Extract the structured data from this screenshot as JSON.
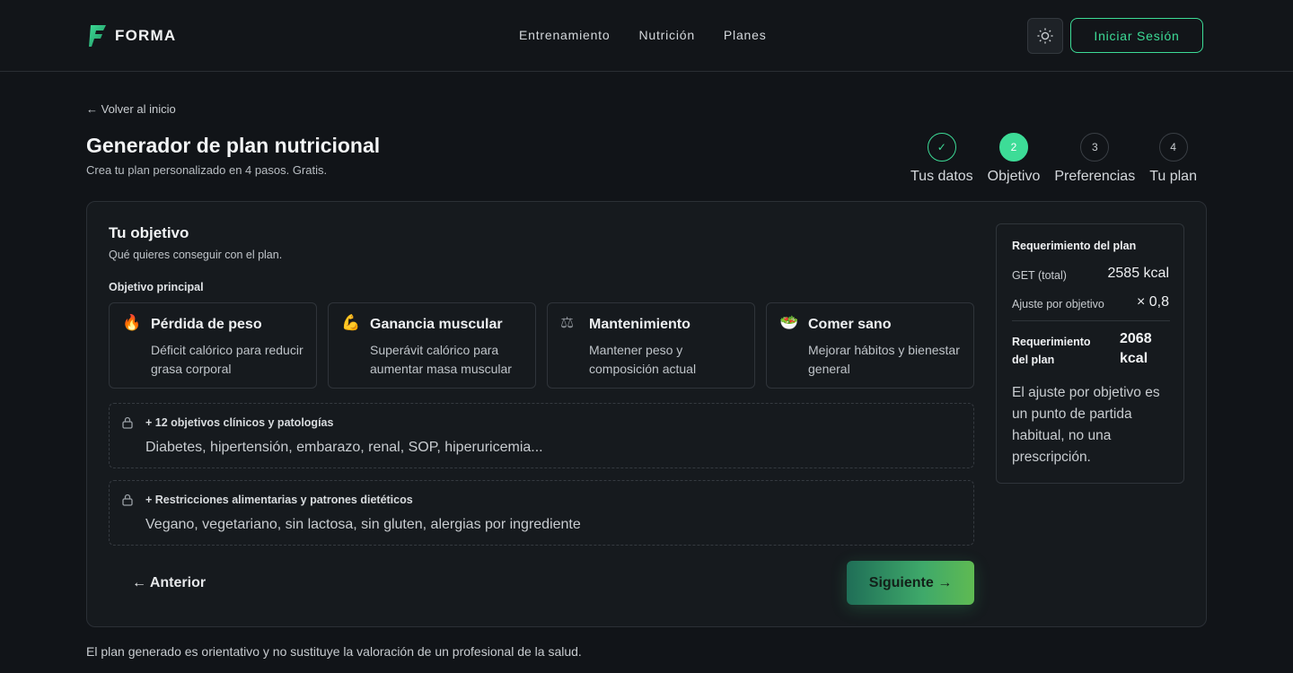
{
  "header": {
    "brand": "FORMA",
    "nav": [
      "Entrenamiento",
      "Nutrición",
      "Planes"
    ],
    "login_label": "Iniciar Sesión",
    "theme_icon": "sun-icon"
  },
  "page": {
    "back_link": "← Volver al inicio",
    "title": "Generador de plan nutricional",
    "subtitle": "Crea tu plan personalizado en 4 pasos. Gratis."
  },
  "stepper": {
    "steps": [
      {
        "number": "✓",
        "label": "Tus datos",
        "state": "done"
      },
      {
        "number": "2",
        "label": "Objetivo",
        "state": "active"
      },
      {
        "number": "3",
        "label": "Preferencias",
        "state": "pending"
      },
      {
        "number": "4",
        "label": "Tu plan",
        "state": "pending"
      }
    ]
  },
  "objective": {
    "title": "Tu objetivo",
    "subtitle": "Qué quieres conseguir con el plan.",
    "field_label": "Objetivo principal",
    "options": [
      {
        "icon": "🔥",
        "icon_name": "fire-icon",
        "title": "Pérdida de peso",
        "desc": "Déficit calórico para reducir grasa corporal"
      },
      {
        "icon": "💪",
        "icon_name": "muscle-icon",
        "title": "Ganancia muscular",
        "desc": "Superávit calórico para aumentar masa muscular"
      },
      {
        "icon": "⚖",
        "icon_name": "scale-icon",
        "title": "Mantenimiento",
        "desc": "Mantener peso y composición actual"
      },
      {
        "icon": "🥗",
        "icon_name": "salad-icon",
        "title": "Comer sano",
        "desc": "Mejorar hábitos y bienestar general"
      }
    ],
    "locked": [
      {
        "title": "+ 12 objetivos clínicos y patologías",
        "desc": "Diabetes, hipertensión, embarazo, renal, SOP, hiperuricemia..."
      },
      {
        "title": "+ Restricciones alimentarias y patrones dietéticos",
        "desc": "Vegano, vegetariano, sin lactosa, sin gluten, alergias por ingrediente"
      }
    ],
    "prev_label": "← Anterior",
    "next_label": "Siguiente →"
  },
  "summary": {
    "title": "Requerimiento del plan",
    "get_label": "GET (total)",
    "get_value": "2585 kcal",
    "adjust_label": "Ajuste por objetivo",
    "adjust_value": "× 0,8",
    "req_label": "Requerimiento del plan",
    "req_value": "2068 kcal",
    "note": "El ajuste por objetivo es un punto de partida habitual, no una prescripción."
  },
  "disclaimer": "El plan generado es orientativo y no sustituye la valoración de un profesional de la salud.",
  "colors": {
    "accent": "#3ddc97",
    "background": "#111418",
    "card": "#161a1e"
  }
}
